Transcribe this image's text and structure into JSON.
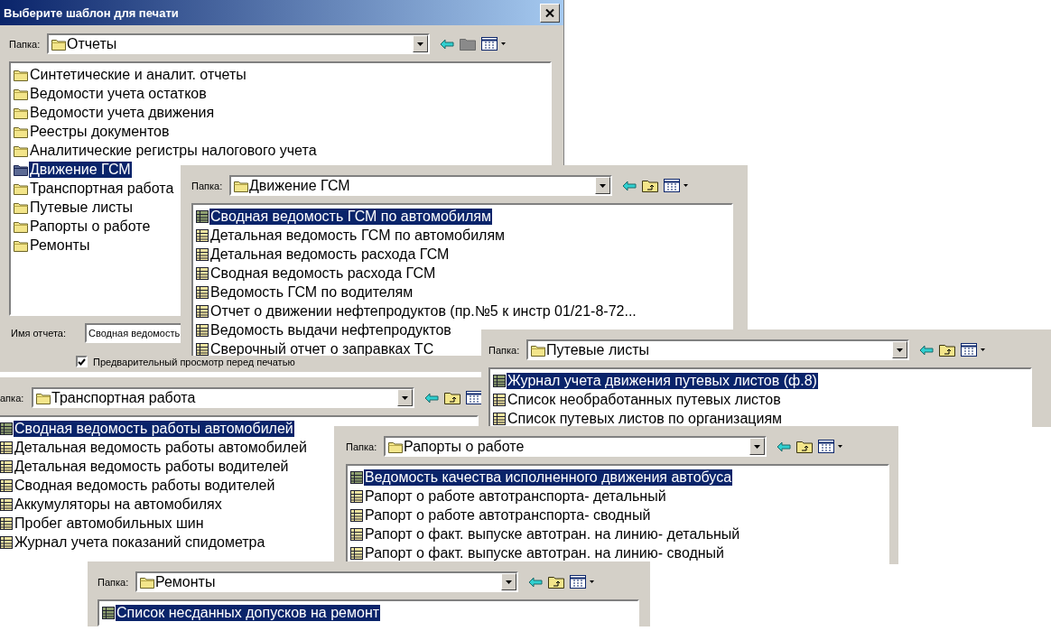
{
  "dialog": {
    "title": "Выберите шаблон для печати",
    "browser": {
      "folder_label": "Папка:",
      "folder": "Отчеты",
      "up_disabled": true,
      "items": [
        {
          "label": "Синтетические и аналит. отчеты",
          "kind": "folder",
          "selected": false
        },
        {
          "label": "Ведомости учета остатков",
          "kind": "folder",
          "selected": false
        },
        {
          "label": "Ведомости учета движения",
          "kind": "folder",
          "selected": false
        },
        {
          "label": "Реестры документов",
          "kind": "folder",
          "selected": false
        },
        {
          "label": "Аналитические регистры налогового учета",
          "kind": "folder",
          "selected": false
        },
        {
          "label": "Движение ГСМ",
          "kind": "folder",
          "selected": true
        },
        {
          "label": "Транспортная работа",
          "kind": "folder",
          "selected": false
        },
        {
          "label": "Путевые листы",
          "kind": "folder",
          "selected": false
        },
        {
          "label": "Рапорты о работе",
          "kind": "folder",
          "selected": false
        },
        {
          "label": "Ремонты",
          "kind": "folder",
          "selected": false
        }
      ]
    },
    "report_name_label": "Имя отчета:",
    "report_name": "Сводная ведомость",
    "preview_label": "Предварительный просмотр перед печатью",
    "preview_checked": true
  },
  "panels": [
    {
      "folder_label": "Папка:",
      "folder": "Движение ГСМ",
      "up_disabled": false,
      "items": [
        {
          "label": "Сводная ведомость ГСМ по автомобилям",
          "kind": "report",
          "selected": true
        },
        {
          "label": "Детальная ведомость ГСМ по автомобилям",
          "kind": "report",
          "selected": false
        },
        {
          "label": "Детальная ведомость расхода ГСМ",
          "kind": "report",
          "selected": false
        },
        {
          "label": "Сводная ведомость расхода ГСМ",
          "kind": "report",
          "selected": false
        },
        {
          "label": "Ведомость ГСМ по водителям",
          "kind": "report",
          "selected": false
        },
        {
          "label": "Отчет о движении нефтепродуктов (пр.№5 к инстр 01/21-8-72...",
          "kind": "report",
          "selected": false
        },
        {
          "label": "Ведомость выдачи нефтепродуктов",
          "kind": "report",
          "selected": false
        },
        {
          "label": "Сверочный отчет о заправках ТС",
          "kind": "report",
          "selected": false
        }
      ]
    },
    {
      "folder_label": "Папка:",
      "folder": "Путевые листы",
      "up_disabled": false,
      "items": [
        {
          "label": "Журнал учета движения путевых листов (ф.8)",
          "kind": "report",
          "selected": true
        },
        {
          "label": "Список необработанных путевых листов",
          "kind": "report",
          "selected": false
        },
        {
          "label": "Список путевых листов по организациям",
          "kind": "report",
          "selected": false
        }
      ]
    },
    {
      "folder_label": "апка:",
      "folder": "Транспортная работа",
      "up_disabled": false,
      "items": [
        {
          "label": "Сводная ведомость работы автомобилей",
          "kind": "report",
          "selected": true
        },
        {
          "label": "Детальная ведомость работы автомобилей",
          "kind": "report",
          "selected": false
        },
        {
          "label": "Детальная ведомость работы водителей",
          "kind": "report",
          "selected": false
        },
        {
          "label": "Сводная ведомость работы водителей",
          "kind": "report",
          "selected": false
        },
        {
          "label": "Аккумуляторы на автомобилях",
          "kind": "report",
          "selected": false
        },
        {
          "label": "Пробег автомобильных шин",
          "kind": "report",
          "selected": false
        },
        {
          "label": "Журнал учета показаний спидометра",
          "kind": "report",
          "selected": false
        }
      ]
    },
    {
      "folder_label": "Папка:",
      "folder": "Рапорты о работе",
      "up_disabled": false,
      "items": [
        {
          "label": "Ведомость качества исполненного движения автобуса",
          "kind": "report",
          "selected": true
        },
        {
          "label": "Рапорт о работе автотранспорта- детальный",
          "kind": "report",
          "selected": false
        },
        {
          "label": "Рапорт о работе автотранспорта- сводный",
          "kind": "report",
          "selected": false
        },
        {
          "label": "Рапорт о факт. выпуске автотран. на линию- детальный",
          "kind": "report",
          "selected": false
        },
        {
          "label": "Рапорт о факт. выпуске автотран. на линию- сводный",
          "kind": "report",
          "selected": false
        }
      ]
    },
    {
      "folder_label": "Папка:",
      "folder": "Ремонты",
      "up_disabled": false,
      "items": [
        {
          "label": "Список несданных допусков на ремонт",
          "kind": "report",
          "selected": true
        }
      ]
    }
  ]
}
